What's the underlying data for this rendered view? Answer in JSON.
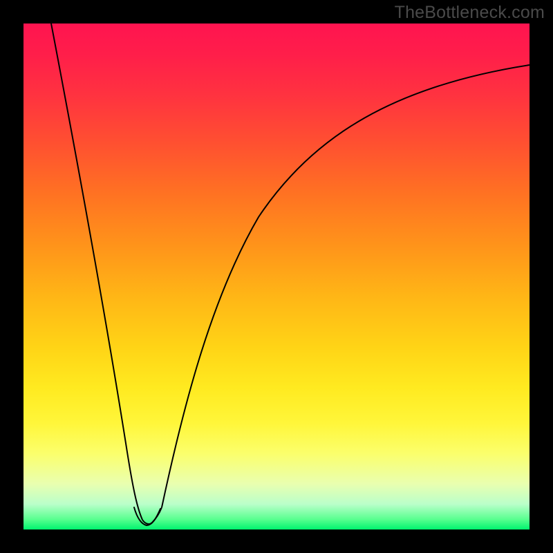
{
  "watermark": "TheBottleneck.com",
  "colors": {
    "frame_bg": "#000000",
    "curve_stroke": "#000000",
    "notch_stroke": "#cf5864",
    "gradient_stops": [
      "#ff1450",
      "#ff3240",
      "#ff7322",
      "#ffb616",
      "#ffea20",
      "#fbff6c",
      "#baffca",
      "#00f46e"
    ]
  },
  "chart_data": {
    "type": "line",
    "title": "",
    "xlabel": "",
    "ylabel": "",
    "xlim": [
      0,
      100
    ],
    "ylim": [
      0,
      100
    ],
    "x": [
      0,
      2,
      4,
      6,
      8,
      10,
      12,
      14,
      16,
      18,
      20,
      21,
      22,
      23,
      24,
      25,
      26,
      28,
      30,
      33,
      36,
      40,
      45,
      50,
      55,
      60,
      65,
      70,
      75,
      80,
      85,
      90,
      95,
      100
    ],
    "values": [
      100,
      91,
      82,
      73,
      64,
      55,
      46,
      37,
      28,
      18,
      8,
      3,
      1,
      0.5,
      1,
      3,
      8,
      18,
      28,
      38,
      46,
      54,
      62,
      68,
      73,
      77,
      80,
      83,
      85,
      87,
      88.5,
      90,
      91,
      92
    ],
    "notch_x_range": [
      20.5,
      25.5
    ],
    "notch_y": 1
  }
}
